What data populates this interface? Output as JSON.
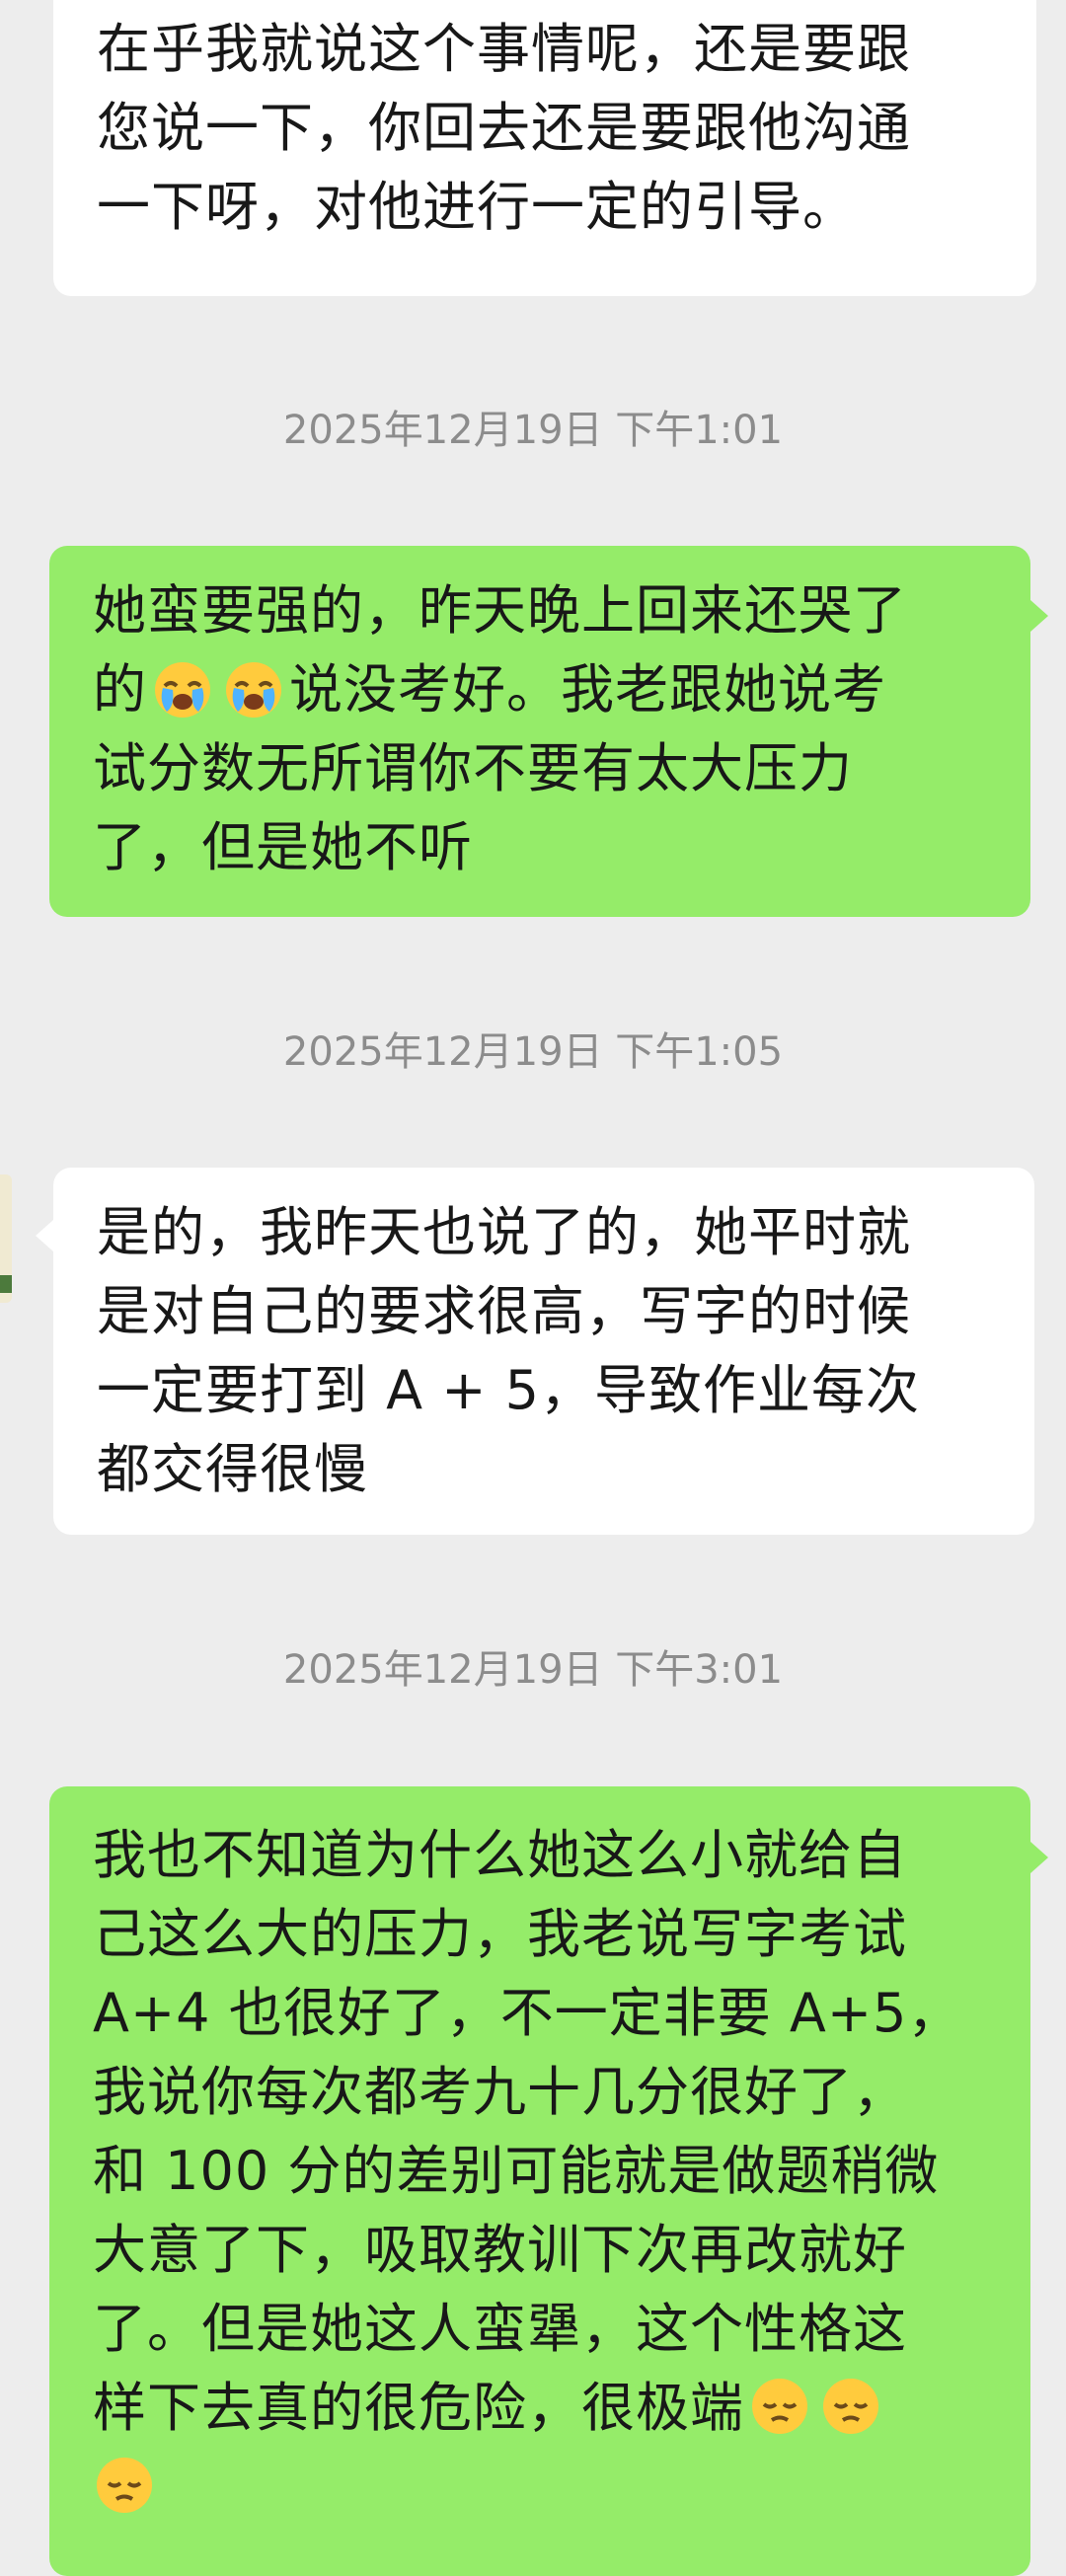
{
  "messages": [
    {
      "direction": "in",
      "lines": [
        "在乎我就说这个事情呢，还是要跟",
        "您说一下，你回去还是要跟他沟通",
        "一下呀，对他进行一定的引导。"
      ]
    },
    {
      "direction": "out",
      "timestamp": "2025年12月19日 下午1:01",
      "line1": "她蛮要强的，昨天晚上回来还哭了",
      "line2_prefix": "的",
      "line2_suffix": "说没考好。我老跟她说考",
      "line3": "试分数无所谓你不要有太大压力",
      "line4": "了，但是她不听"
    },
    {
      "direction": "in",
      "timestamp": "2025年12月19日 下午1:05",
      "lines": [
        "是的，我昨天也说了的，她平时就",
        "是对自己的要求很高，写字的时候",
        "一定要打到 A + 5，导致作业每次",
        "都交得很慢"
      ]
    },
    {
      "direction": "out",
      "timestamp": "2025年12月19日 下午3:01",
      "lines": [
        "我也不知道为什么她这么小就给自",
        "己这么大的压力，我老说写字考试",
        "A+4 也很好了，不一定非要 A+5，",
        "我说你每次都考九十几分很好了，",
        "和 100 分的差别可能就是做题稍微",
        "大意了下，吸取教训下次再改就好",
        "了。但是她这人蛮犟，这个性格这"
      ],
      "last_line_text": "样下去真的很危险，很极端"
    }
  ],
  "emojis": [
    "loudly-crying-face",
    "pensive-face"
  ],
  "colors": {
    "background": "#ededed",
    "incoming": "#ffffff",
    "outgoing": "#95ec69",
    "timestamp": "#8c8c8c",
    "text": "#181818"
  }
}
